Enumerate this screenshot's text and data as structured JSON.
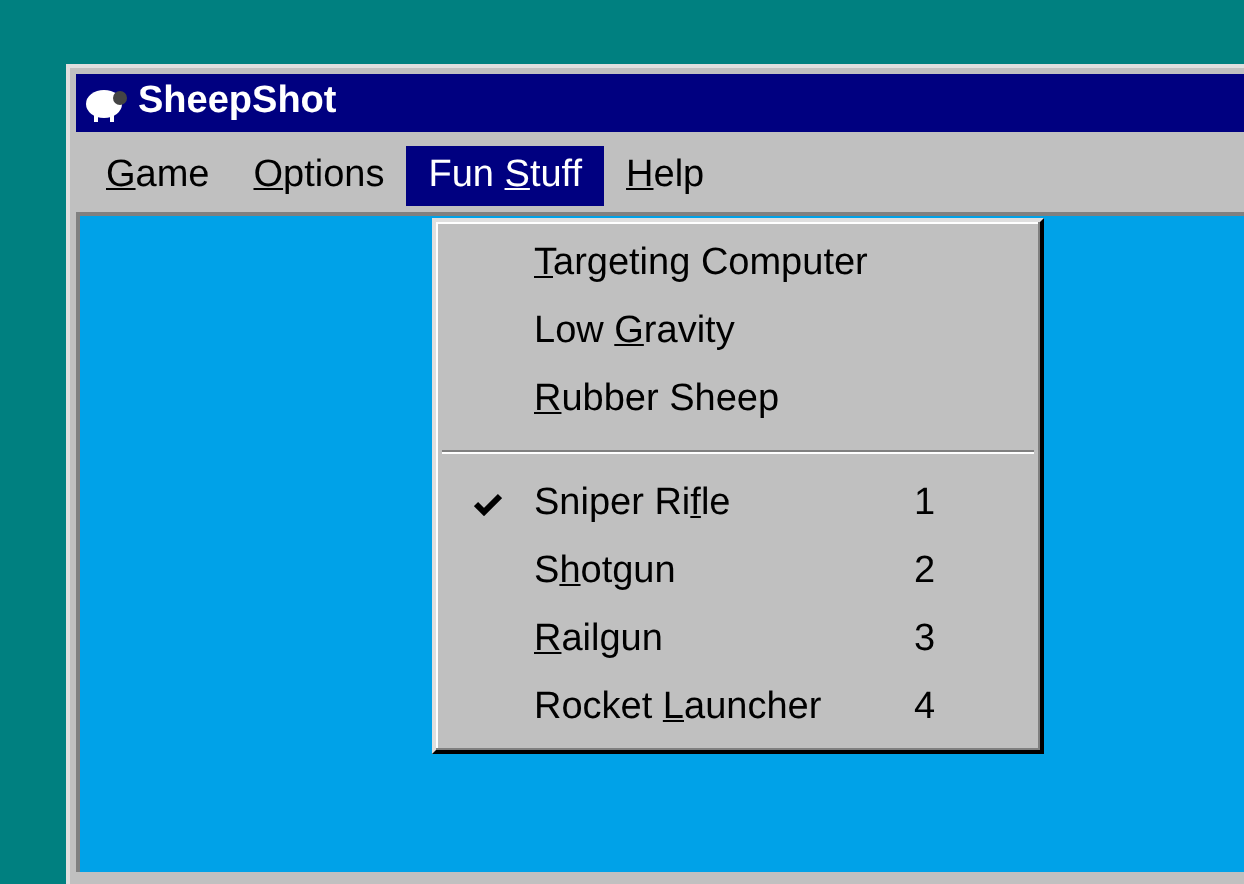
{
  "window": {
    "title": "SheepShot"
  },
  "menu_bar": [
    {
      "key": "G",
      "after": "ame",
      "selected": false
    },
    {
      "key": "O",
      "after": "ptions",
      "selected": false
    },
    {
      "before": "Fun ",
      "key": "S",
      "after": "tuff",
      "selected": true
    },
    {
      "key": "H",
      "after": "elp",
      "selected": false
    }
  ],
  "dropdown": {
    "items": [
      {
        "kind": "item",
        "key": "T",
        "after": "argeting Computer",
        "checked": false
      },
      {
        "kind": "item",
        "before": "Low ",
        "key": "G",
        "after": "ravity",
        "checked": false
      },
      {
        "kind": "item",
        "key": "R",
        "after": "ubber Sheep",
        "checked": false
      },
      {
        "kind": "separator"
      },
      {
        "kind": "item",
        "before": "Sniper Ri",
        "key": "f",
        "after": "le",
        "checked": true,
        "shortcut": "1"
      },
      {
        "kind": "item",
        "before": "S",
        "key": "h",
        "after": "otgun",
        "checked": false,
        "shortcut": "2"
      },
      {
        "kind": "item",
        "key": "R",
        "after": "ailgun",
        "checked": false,
        "shortcut": "3"
      },
      {
        "kind": "item",
        "before": "Rocket ",
        "key": "L",
        "after": "auncher",
        "checked": false,
        "shortcut": "4"
      }
    ]
  }
}
